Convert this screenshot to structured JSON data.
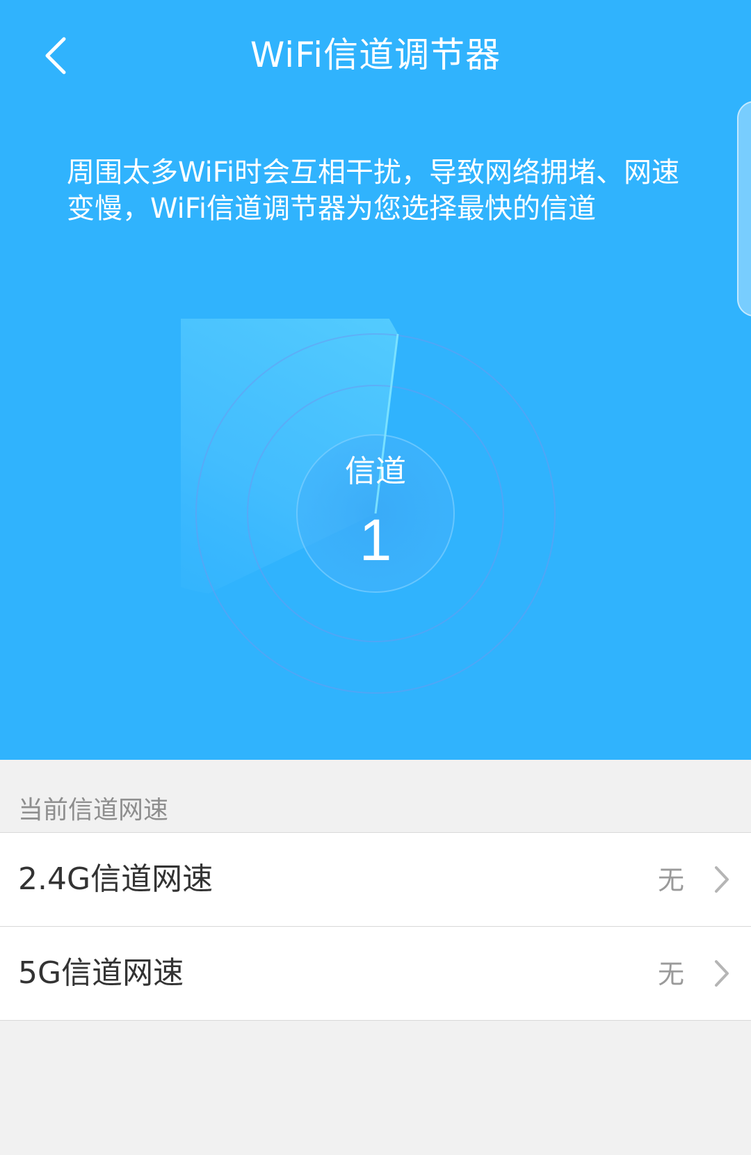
{
  "header": {
    "title": "WiFi信道调节器",
    "back_icon": "chevron-left-icon"
  },
  "hero": {
    "description": "周围太多WiFi时会互相干扰，导致网络拥堵、网速变慢，WiFi信道调节器为您选择最快的信道",
    "radar": {
      "label": "信道",
      "value": "1"
    }
  },
  "section": {
    "header": "当前信道网速"
  },
  "list": {
    "items": [
      {
        "label": "2.4G信道网速",
        "value": "无"
      },
      {
        "label": "5G信道网速",
        "value": "无"
      }
    ]
  },
  "colors": {
    "hero_background": "#30b3fd",
    "page_background": "#f1f1f1",
    "list_background": "#ffffff"
  }
}
